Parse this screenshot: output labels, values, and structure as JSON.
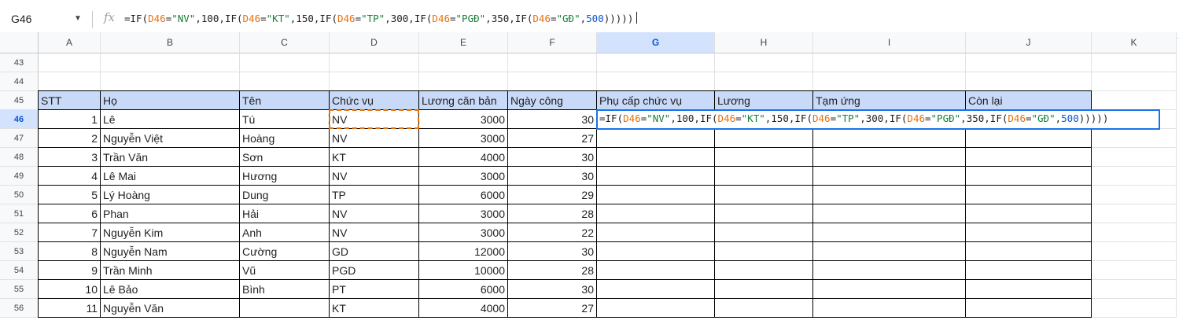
{
  "name_box": "G46",
  "fx_label": "fx",
  "formula": [
    {
      "t": "=IF(",
      "c": "plain"
    },
    {
      "t": "D46",
      "c": "ref"
    },
    {
      "t": "=",
      "c": "plain"
    },
    {
      "t": "\"NV\"",
      "c": "str"
    },
    {
      "t": ",100,IF(",
      "c": "plain"
    },
    {
      "t": "D46",
      "c": "ref"
    },
    {
      "t": "=",
      "c": "plain"
    },
    {
      "t": "\"KT\"",
      "c": "str"
    },
    {
      "t": ",150,IF(",
      "c": "plain"
    },
    {
      "t": "D46",
      "c": "ref"
    },
    {
      "t": "=",
      "c": "plain"
    },
    {
      "t": "\"TP\"",
      "c": "str"
    },
    {
      "t": ",300,IF(",
      "c": "plain"
    },
    {
      "t": "D46",
      "c": "ref"
    },
    {
      "t": "=",
      "c": "plain"
    },
    {
      "t": "\"PGĐ\"",
      "c": "str"
    },
    {
      "t": ",350,IF(",
      "c": "plain"
    },
    {
      "t": "D46",
      "c": "ref"
    },
    {
      "t": "=",
      "c": "plain"
    },
    {
      "t": "\"GĐ\"",
      "c": "str"
    },
    {
      "t": ",",
      "c": "plain"
    },
    {
      "t": "500",
      "c": "blue"
    },
    {
      "t": ")))))",
      "c": "plain"
    }
  ],
  "columns": [
    "A",
    "B",
    "C",
    "D",
    "E",
    "F",
    "G",
    "H",
    "I",
    "J",
    "K"
  ],
  "selected_column": "G",
  "selected_row": "46",
  "header_row": {
    "row": "45",
    "cells": [
      "STT",
      "Họ",
      "Tên",
      "Chức vụ",
      "Lương căn bản",
      "Ngày công",
      "Phụ cấp chức vụ",
      "Lương",
      "Tạm ứng",
      "Còn lại"
    ]
  },
  "rows": [
    {
      "row": "43",
      "cells": []
    },
    {
      "row": "44",
      "cells": []
    },
    {
      "row": "46",
      "cells": [
        "1",
        "Lê",
        "Tú",
        "NV",
        "3000",
        "30",
        "",
        "",
        "",
        ""
      ]
    },
    {
      "row": "47",
      "cells": [
        "2",
        "Nguyễn Việt",
        "Hoàng",
        "NV",
        "3000",
        "27",
        "",
        "",
        "",
        ""
      ]
    },
    {
      "row": "48",
      "cells": [
        "3",
        "Trần Văn",
        "Sơn",
        "KT",
        "4000",
        "30",
        "",
        "",
        "",
        ""
      ]
    },
    {
      "row": "49",
      "cells": [
        "4",
        "Lê Mai",
        "Hương",
        "NV",
        "3000",
        "30",
        "",
        "",
        "",
        ""
      ]
    },
    {
      "row": "50",
      "cells": [
        "5",
        "Lý Hoàng",
        "Dung",
        "TP",
        "6000",
        "29",
        "",
        "",
        "",
        ""
      ]
    },
    {
      "row": "51",
      "cells": [
        "6",
        "Phan",
        "Hải",
        "NV",
        "3000",
        "28",
        "",
        "",
        "",
        ""
      ]
    },
    {
      "row": "52",
      "cells": [
        "7",
        "Nguyễn Kim",
        "Anh",
        "NV",
        "3000",
        "22",
        "",
        "",
        "",
        ""
      ]
    },
    {
      "row": "53",
      "cells": [
        "8",
        "Nguyễn Nam",
        "Cường",
        "GD",
        "12000",
        "30",
        "",
        "",
        "",
        ""
      ]
    },
    {
      "row": "54",
      "cells": [
        "9",
        "Trần Minh",
        "Vũ",
        "PGD",
        "10000",
        "28",
        "",
        "",
        "",
        ""
      ]
    },
    {
      "row": "55",
      "cells": [
        "10",
        "Lê Bảo",
        "Bình",
        "PT",
        "6000",
        "30",
        "",
        "",
        "",
        ""
      ]
    },
    {
      "row": "56",
      "cells": [
        "11",
        "Nguyễn Văn",
        "",
        "KT",
        "4000",
        "27",
        "",
        "",
        "",
        ""
      ]
    }
  ],
  "colors": {
    "header_fill": "#c9daf8",
    "selection": "#1a73e8",
    "ref_highlight": "#e8710a",
    "string": "#188038"
  }
}
